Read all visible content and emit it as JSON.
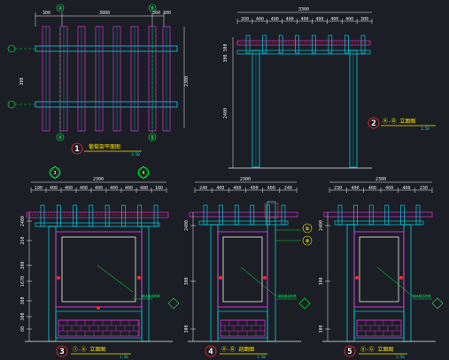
{
  "colors": {
    "background": "#1b1e24",
    "cyan": "#00e5ff",
    "magenta": "#ff33ff",
    "red": "#ff2a2a",
    "green": "#00ff44",
    "yellow": "#ffe600",
    "white": "#f0f0f0"
  },
  "plan": {
    "dim_top": "3800",
    "dim_top_left": "300",
    "dim_top_right": "300 300",
    "dim_right": "2300",
    "dim_left": "300",
    "axis_left": "A",
    "axis_right": "B",
    "axis_bottom_left": "A",
    "axis_bottom_right": "B",
    "title_number": "1",
    "title": "葡萄架平面图",
    "scale": "1:50"
  },
  "elevation_main": {
    "dim_top": "3300",
    "segments": [
      "300",
      "400",
      "400",
      "400",
      "400",
      "400",
      "400",
      "400",
      "300"
    ],
    "dim_left_upper": "300",
    "dim_left_mid": "300",
    "dim_left_height": "2400",
    "title_number": "2",
    "title": "Ⓐ-Ⓑ 立面图",
    "scale": "1:50"
  },
  "elev3": {
    "axis_left": "3",
    "axis_right": "4",
    "dim_top": "2300",
    "segments": [
      "100",
      "400",
      "400",
      "400",
      "400",
      "400",
      "400",
      "400",
      "100"
    ],
    "dims_left": [
      "2400",
      "250",
      "300",
      "1670",
      "300",
      "300",
      "80"
    ],
    "title_number": "3",
    "title": "①-④ 立面图",
    "scale": "1:50",
    "note": "钢木组合构件"
  },
  "elev4": {
    "dim_top": "2300",
    "segments": [
      "240",
      "400",
      "400",
      "400",
      "400",
      "240"
    ],
    "dims_left": [
      "2400",
      "300",
      "300"
    ],
    "title_number": "4",
    "title": "Ⓐ-Ⓑ 剖面图",
    "scale": "1:50",
    "callouts": [
      "①",
      "②"
    ],
    "note": "钢木组合构件"
  },
  "elev5": {
    "dim_top": "2300",
    "segments": [
      "230",
      "400",
      "400",
      "400",
      "400",
      "230"
    ],
    "dims_left": [
      "2400",
      "300",
      "300"
    ],
    "title_number": "5",
    "title": "⑤-⑥ 立面图",
    "scale": "1:50",
    "note": "钢木组合构件"
  }
}
